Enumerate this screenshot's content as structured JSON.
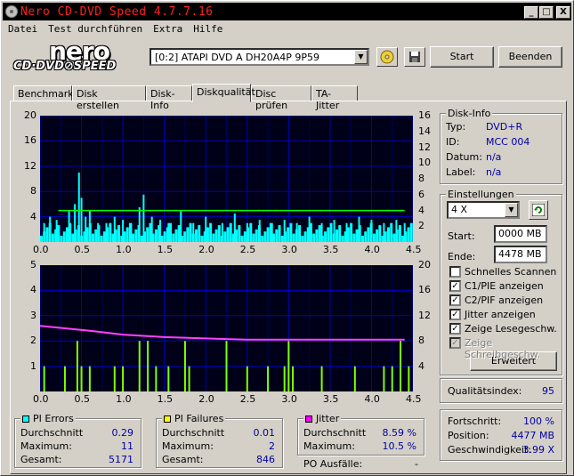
{
  "window": {
    "title": "Nero CD-DVD Speed 4.7.7.16",
    "controls": {
      "minimize": "_",
      "maximize": "□",
      "close": "X"
    }
  },
  "menu": [
    "Datei",
    "Test durchführen",
    "Extra",
    "Hilfe"
  ],
  "logo": {
    "brand": "nero",
    "product": "CD·DVD⊘SPEED"
  },
  "toolbar": {
    "drive": "[0:2]   ATAPI DVD A  DH20A4P 9P59",
    "start": "Start",
    "stop": "Beenden"
  },
  "tabs": [
    "Benchmark",
    "Disk erstellen",
    "Disk-Info",
    "Diskqualität",
    "Disc prüfen",
    "TA-Jitter"
  ],
  "active_tab": "Diskqualität",
  "disk_info": {
    "title": "Disk-Info",
    "rows": [
      {
        "label": "Typ:",
        "value": "DVD+R"
      },
      {
        "label": "ID:",
        "value": "MCC 004"
      },
      {
        "label": "Datum:",
        "value": "n/a"
      },
      {
        "label": "Label:",
        "value": "n/a"
      }
    ]
  },
  "settings": {
    "title": "Einstellungen",
    "speed": "4 X",
    "start_label": "Start:",
    "start_value": "0000 MB",
    "end_label": "Ende:",
    "end_value": "4478 MB",
    "options": [
      {
        "label": "Schnelles Scannen",
        "checked": false,
        "disabled": false
      },
      {
        "label": "C1/PIE anzeigen",
        "checked": true,
        "disabled": false
      },
      {
        "label": "C2/PIF anzeigen",
        "checked": true,
        "disabled": false
      },
      {
        "label": "Jitter anzeigen",
        "checked": true,
        "disabled": false
      },
      {
        "label": "Zeige Lesegeschw.",
        "checked": true,
        "disabled": false
      },
      {
        "label": "Zeige Schreibgeschw.",
        "checked": true,
        "disabled": true
      }
    ],
    "advanced": "Erweitert"
  },
  "quality": {
    "label": "Qualitätsindex:",
    "value": "95"
  },
  "progress": {
    "rows": [
      {
        "label": "Fortschritt:",
        "value": "100 %"
      },
      {
        "label": "Position:",
        "value": "4477 MB"
      },
      {
        "label": "Geschwindigkeit:",
        "value": "3.99 X"
      }
    ]
  },
  "pi_errors": {
    "title": "PI Errors",
    "color": "#00ffff",
    "rows": [
      {
        "label": "Durchschnitt",
        "value": "0.29"
      },
      {
        "label": "Maximum:",
        "value": "11"
      },
      {
        "label": "Gesamt:",
        "value": "5171"
      }
    ]
  },
  "pi_failures": {
    "title": "PI Failures",
    "color": "#ffff00",
    "rows": [
      {
        "label": "Durchschnitt",
        "value": "0.01"
      },
      {
        "label": "Maximum:",
        "value": "2"
      },
      {
        "label": "Gesamt:",
        "value": "846"
      }
    ]
  },
  "jitter": {
    "title": "Jitter",
    "color": "#ff00ff",
    "rows": [
      {
        "label": "Durchschnitt",
        "value": "8.59 %"
      },
      {
        "label": "Maximum:",
        "value": "10.5 %"
      }
    ]
  },
  "po": {
    "label": "PO Ausfälle:",
    "value": "-"
  },
  "chart_data": [
    {
      "type": "bar",
      "x_ticks": [
        "0.0",
        "0.5",
        "1.0",
        "1.5",
        "2.0",
        "2.5",
        "3.0",
        "3.5",
        "4.0",
        "4.5"
      ],
      "y_left_ticks": [
        "20",
        "16",
        "12",
        "8",
        "4"
      ],
      "y_right_ticks": [
        "16",
        "14",
        "12",
        "10",
        "8",
        "6",
        "4",
        "2"
      ],
      "xlim": [
        0,
        4.5
      ],
      "ylim": [
        0,
        20
      ],
      "y2lim": [
        0,
        16
      ],
      "grid": true,
      "series": [
        {
          "color": "#00ffff",
          "peaks": [
            [
              0.05,
              3
            ],
            [
              0.12,
              4
            ],
            [
              0.2,
              3.5
            ],
            [
              0.35,
              5
            ],
            [
              0.42,
              6
            ],
            [
              0.47,
              11
            ],
            [
              0.5,
              7
            ],
            [
              0.55,
              4
            ],
            [
              0.6,
              5
            ],
            [
              0.7,
              3
            ],
            [
              0.8,
              3
            ],
            [
              0.9,
              4
            ],
            [
              1.0,
              3.5
            ],
            [
              1.1,
              3
            ],
            [
              1.2,
              5.5
            ],
            [
              1.25,
              7.5
            ],
            [
              1.35,
              4
            ],
            [
              1.45,
              3.5
            ],
            [
              1.55,
              3
            ],
            [
              1.7,
              5
            ],
            [
              1.85,
              3
            ],
            [
              2.0,
              4
            ],
            [
              2.2,
              3
            ],
            [
              2.35,
              4.5
            ],
            [
              2.5,
              3
            ],
            [
              2.65,
              3.5
            ],
            [
              2.8,
              3
            ],
            [
              2.95,
              3.5
            ],
            [
              3.1,
              3
            ],
            [
              3.25,
              4
            ],
            [
              3.4,
              3
            ],
            [
              3.55,
              3.5
            ],
            [
              3.7,
              3
            ],
            [
              3.85,
              4
            ],
            [
              4.0,
              3.5
            ],
            [
              4.15,
              3
            ],
            [
              4.3,
              3.5
            ],
            [
              4.4,
              3
            ]
          ]
        },
        {
          "color": "#00ff00",
          "speed_level": 3.99
        }
      ]
    },
    {
      "type": "bar",
      "x_ticks": [
        "0.0",
        "0.5",
        "1.0",
        "1.5",
        "2.0",
        "2.5",
        "3.0",
        "3.5",
        "4.0",
        "4.5"
      ],
      "y_left_ticks": [
        "5",
        "4",
        "3",
        "2",
        "1"
      ],
      "y_right_ticks": [
        "20",
        "16",
        "12",
        "8",
        "4"
      ],
      "xlim": [
        0,
        4.5
      ],
      "ylim": [
        0,
        5
      ],
      "y2lim": [
        0,
        20
      ],
      "grid": true,
      "series": [
        {
          "color": "#80ff00",
          "peaks": [
            [
              0.05,
              1
            ],
            [
              0.3,
              1
            ],
            [
              0.45,
              2
            ],
            [
              0.5,
              1
            ],
            [
              0.6,
              1
            ],
            [
              0.9,
              1
            ],
            [
              1.0,
              1
            ],
            [
              1.2,
              2
            ],
            [
              1.3,
              2
            ],
            [
              1.4,
              1
            ],
            [
              1.55,
              1
            ],
            [
              1.75,
              2
            ],
            [
              1.8,
              1
            ],
            [
              2.25,
              2
            ],
            [
              2.5,
              1
            ],
            [
              2.75,
              1
            ],
            [
              2.95,
              1
            ],
            [
              3.0,
              2
            ],
            [
              3.05,
              1
            ],
            [
              3.4,
              1
            ],
            [
              3.8,
              1
            ],
            [
              4.15,
              1
            ],
            [
              4.25,
              1
            ],
            [
              4.35,
              2
            ],
            [
              4.45,
              1
            ]
          ]
        },
        {
          "color": "#ff40ff",
          "jitter": [
            [
              0,
              2.6
            ],
            [
              0.3,
              2.5
            ],
            [
              0.6,
              2.4
            ],
            [
              1.0,
              2.25
            ],
            [
              1.5,
              2.15
            ],
            [
              2.0,
              2.1
            ],
            [
              2.5,
              2.05
            ],
            [
              3.0,
              2.05
            ],
            [
              3.5,
              2.05
            ],
            [
              4.0,
              2.05
            ],
            [
              4.4,
              2.05
            ]
          ]
        }
      ]
    }
  ]
}
